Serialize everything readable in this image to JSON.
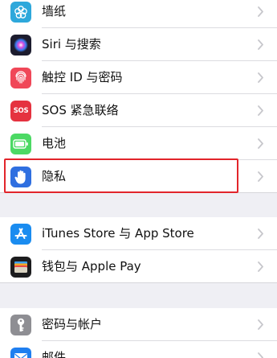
{
  "groups": [
    {
      "rows": [
        {
          "id": "wallpaper",
          "label": "墙纸",
          "icon": "wallpaper-icon",
          "icon_color": "#2ea8db"
        },
        {
          "id": "siri",
          "label": "Siri 与搜索",
          "icon": "siri-icon",
          "icon_color": "#1c1c2e"
        },
        {
          "id": "touch-id",
          "label": "触控 ID 与密码",
          "icon": "fingerprint-icon",
          "icon_color": "#f04758"
        },
        {
          "id": "sos",
          "label": "SOS 紧急联络",
          "icon": "sos-icon",
          "icon_color": "#e5323f",
          "icon_text": "SOS"
        },
        {
          "id": "battery",
          "label": "电池",
          "icon": "battery-icon",
          "icon_color": "#4cd964"
        },
        {
          "id": "privacy",
          "label": "隐私",
          "icon": "hand-icon",
          "icon_color": "#2f6fe0"
        }
      ]
    },
    {
      "rows": [
        {
          "id": "itunes",
          "label": "iTunes Store 与 App Store",
          "icon": "app-store-icon",
          "icon_color": "#1a8cf0"
        },
        {
          "id": "wallet",
          "label": "钱包与 Apple Pay",
          "icon": "wallet-icon",
          "icon_color": "#1c1c1e"
        }
      ]
    },
    {
      "rows": [
        {
          "id": "passwords",
          "label": "密码与帐户",
          "icon": "key-icon",
          "icon_color": "#8e8e93"
        },
        {
          "id": "mail",
          "label": "邮件",
          "icon": "mail-icon",
          "icon_color": "#1f7ff0"
        }
      ]
    }
  ],
  "colors": {
    "background": "#efeff4",
    "highlight": "#e2252b",
    "chevron": "#c7c7cc"
  }
}
